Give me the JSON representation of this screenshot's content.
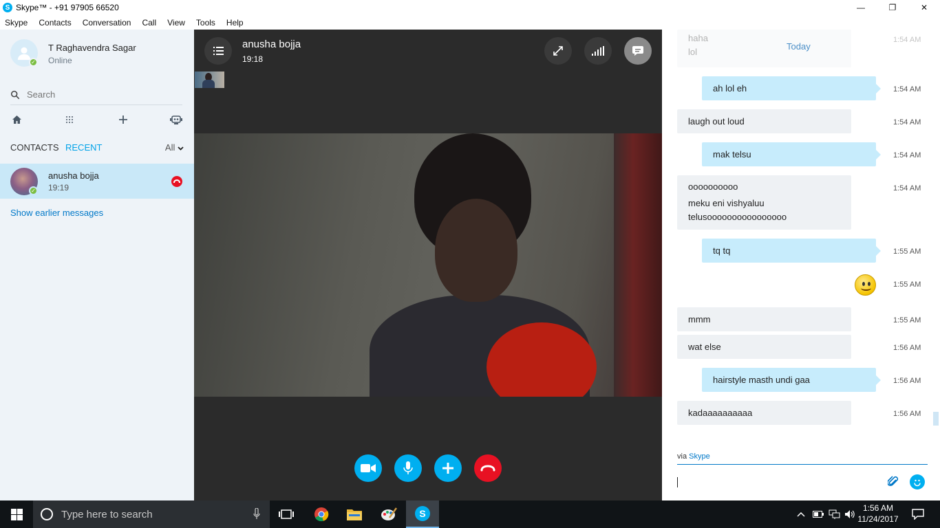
{
  "window": {
    "title": "Skype™ - +91 97905 66520",
    "app_icon": "S",
    "controls": {
      "minimize": "—",
      "maximize": "❐",
      "close": "✕"
    }
  },
  "menubar": [
    "Skype",
    "Contacts",
    "Conversation",
    "Call",
    "View",
    "Tools",
    "Help"
  ],
  "sidebar": {
    "profile": {
      "name": "T Raghavendra Sagar",
      "status": "Online"
    },
    "search": {
      "placeholder": "Search"
    },
    "tabs": {
      "contacts": "CONTACTS",
      "recent": "RECENT",
      "filter": "All"
    },
    "recent": [
      {
        "name": "anusha bojja",
        "time": "19:19"
      }
    ],
    "show_earlier": "Show earlier messages"
  },
  "call": {
    "contact_name": "anusha bojja",
    "duration": "19:18",
    "top_controls": [
      "fullscreen-icon",
      "signal-icon",
      "chat-icon"
    ],
    "bottom_controls": [
      "video-icon",
      "mic-icon",
      "add-icon",
      "hangup-icon"
    ]
  },
  "chat": {
    "today_label": "Today",
    "faded": {
      "lines": [
        "haha",
        "lol"
      ],
      "time": "1:54 AM"
    },
    "messages": [
      {
        "dir": "out",
        "lines": [
          "ah lol eh"
        ],
        "time": "1:54 AM"
      },
      {
        "dir": "in",
        "lines": [
          "laugh out loud"
        ],
        "time": "1:54 AM"
      },
      {
        "dir": "out",
        "lines": [
          "mak telsu"
        ],
        "time": "1:54 AM"
      },
      {
        "dir": "in",
        "lines": [
          "oooooooooo",
          "meku eni vishyaluu",
          "telusoooooooooooooooo"
        ],
        "time": "1:54 AM"
      },
      {
        "dir": "out",
        "lines": [
          "tq tq"
        ],
        "time": "1:55 AM"
      },
      {
        "dir": "out",
        "emoji": "smile",
        "time": "1:55 AM"
      },
      {
        "dir": "in",
        "lines": [
          "mmm"
        ],
        "time": "1:55 AM"
      },
      {
        "dir": "in",
        "lines": [
          "wat else"
        ],
        "time": "1:56 AM"
      },
      {
        "dir": "out",
        "lines": [
          "hairstyle masth undi gaa"
        ],
        "time": "1:56 AM"
      },
      {
        "dir": "in",
        "lines": [
          "kadaaaaaaaaaa"
        ],
        "time": "1:56 AM"
      }
    ],
    "via_prefix": "via",
    "via_link": "Skype"
  },
  "taskbar": {
    "search_placeholder": "Type here to search",
    "apps": [
      "task-view-icon",
      "chrome-icon",
      "file-explorer-icon",
      "paint-icon",
      "skype-icon"
    ],
    "clock_time": "1:56 AM",
    "clock_date": "11/24/2017"
  },
  "colors": {
    "accent": "#00aff0",
    "hangup": "#e81123",
    "online": "#7cbe42",
    "bubble_out": "#c7ecfc",
    "bubble_in": "#eef1f4"
  }
}
